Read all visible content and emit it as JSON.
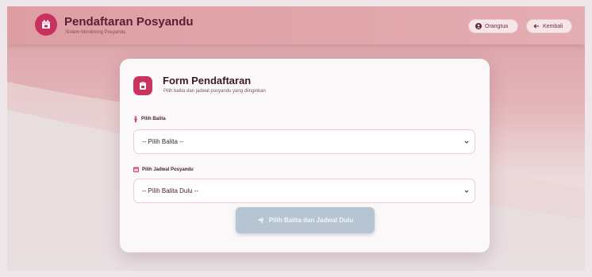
{
  "header": {
    "title": "Pendaftaran Posyandu",
    "subtitle": "Sistem Monitoring Posyandu",
    "user_label": "Orangtua",
    "back_label": "Kembali"
  },
  "form": {
    "title": "Form Pendaftaran",
    "subtitle": "Pilih balita dan jadwal posyandu yang diinginkan",
    "balita_label": "Pilih Balita",
    "balita_value": "-- Pilih Balita --",
    "jadwal_label": "Pilih Jadwal Posyandu",
    "jadwal_value": "-- Pilih Balita Dulu --",
    "submit_label": "Pilih Balita dan Jadwal Dulu"
  },
  "colors": {
    "accent": "#c92f5f",
    "header_bg": "#dd9ea3",
    "disabled_button": "#b7c4d2"
  },
  "icons": {
    "logo": "calendar-icon",
    "user": "user-circle-icon",
    "back": "arrow-left-icon",
    "form": "clipboard-icon",
    "balita": "child-icon",
    "jadwal": "calendar-icon",
    "submit": "paper-plane-icon"
  }
}
